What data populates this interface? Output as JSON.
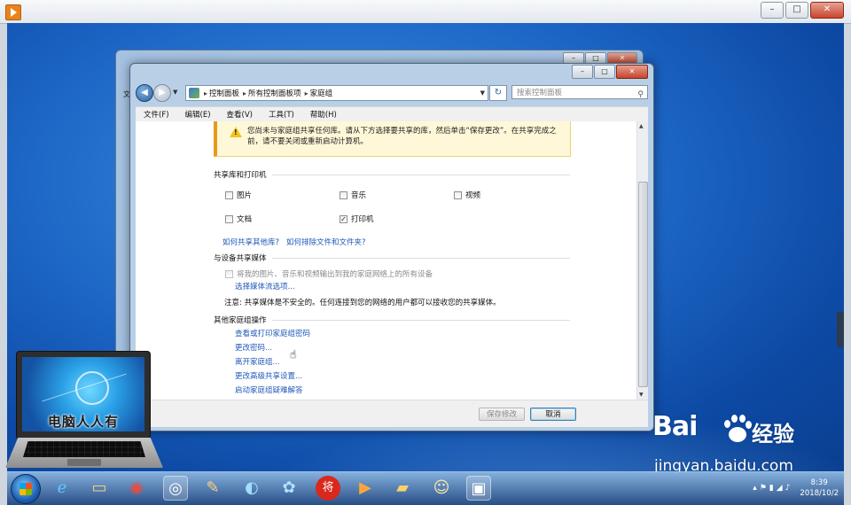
{
  "address": {
    "crumbs": [
      "控制面板",
      "所有控制面板项",
      "家庭组"
    ],
    "separator": "▸",
    "search_placeholder": "搜索控制面板"
  },
  "menu": [
    "文件(F)",
    "编辑(E)",
    "查看(V)",
    "工具(T)",
    "帮助(H)"
  ],
  "back_window": {
    "addr_stub": "文"
  },
  "warning": {
    "text": "您尚未与家庭组共享任何库。请从下方选择要共享的库，然后单击“保存更改”。在共享完成之前，请不要关闭或重新启动计算机。"
  },
  "sections": {
    "libraries": {
      "header": "共享库和打印机",
      "items": [
        {
          "label": "图片",
          "checked": false
        },
        {
          "label": "音乐",
          "checked": false
        },
        {
          "label": "视频",
          "checked": false
        },
        {
          "label": "文档",
          "checked": false
        },
        {
          "label": "打印机",
          "checked": true
        }
      ],
      "link1": "如何共享其他库?",
      "link2": "如何排除文件和文件夹?"
    },
    "media": {
      "header": "与设备共享媒体",
      "checkbox_label": "将我的图片、音乐和视频输出到我的家庭网络上的所有设备",
      "link": "选择媒体流选项...",
      "note": "注意: 共享媒体是不安全的。任何连接到您的网络的用户都可以接收您的共享媒体。"
    },
    "other": {
      "header": "其他家庭组操作",
      "links": [
        "查看或打印家庭组密码",
        "更改密码...",
        "离开家庭组...",
        "更改高级共享设置...",
        "启动家庭组疑难解答"
      ]
    }
  },
  "buttons": {
    "save": "保存修改",
    "cancel": "取消"
  },
  "logo_text": "电脑人人有",
  "watermark": {
    "brand": "Bai",
    "brand_cn": "经验",
    "url": "jingyan.baidu.com"
  },
  "taskbar": {
    "icons": [
      "ie-icon",
      "explorer-icon",
      "chrome-icon",
      "mediacenter-icon",
      "paint-icon",
      "qq-browser-icon",
      "pinwheel-icon",
      "jiang-icon",
      "player-icon",
      "folder-icon",
      "qq-icon",
      "control-panel-icon"
    ],
    "jiang_label": "将",
    "time": "8:39",
    "date": "2018/10/2"
  },
  "colors": {
    "link": "#1f58b8",
    "warning_bg": "#fff8d8",
    "desktop": "#1d66c5"
  }
}
